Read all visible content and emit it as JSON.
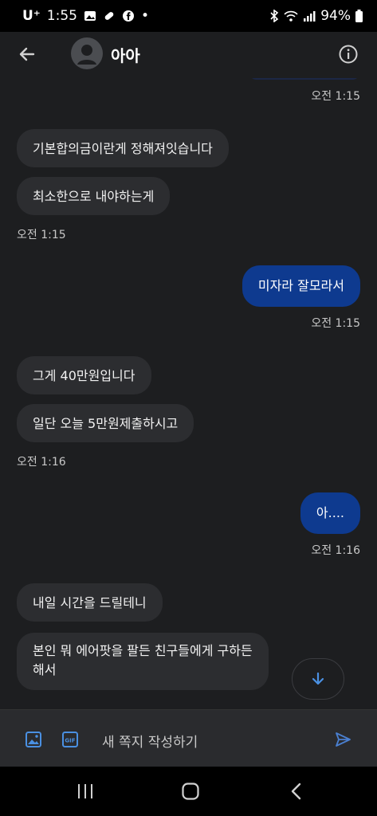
{
  "status_bar": {
    "carrier": "U⁺",
    "time": "1:55",
    "dot": "•",
    "battery": "94%"
  },
  "header": {
    "contact_name": "아아"
  },
  "messages": [
    {
      "dir": "out-partial",
      "time": "오전 1:15"
    },
    {
      "dir": "in",
      "text": "기본합의금이란게 정해져잇습니다"
    },
    {
      "dir": "in",
      "text": "최소한으로 내야하는게",
      "time": "오전 1:15"
    },
    {
      "dir": "out",
      "text": "미자라 잘모라서",
      "time": "오전 1:15"
    },
    {
      "dir": "in",
      "text": "그게 40만원입니다"
    },
    {
      "dir": "in",
      "text": "일단 오늘 5만원제출하시고",
      "time": "오전 1:16"
    },
    {
      "dir": "out",
      "text": "아....",
      "time": "오전 1:16"
    },
    {
      "dir": "in",
      "text": "내일 시간을 드릴테니"
    },
    {
      "dir": "in",
      "text_line1": "본인 뭐 에어팟을 팔든 친구들에게 구하든",
      "text_line2": "해서"
    }
  ],
  "composer": {
    "placeholder": "새 쪽지 작성하기",
    "gif_label": "GIF"
  },
  "colors": {
    "background": "#1d1e20",
    "incoming_bubble": "#2c2d30",
    "outgoing_bubble": "#0e3a8f",
    "accent": "#4a90e2"
  }
}
